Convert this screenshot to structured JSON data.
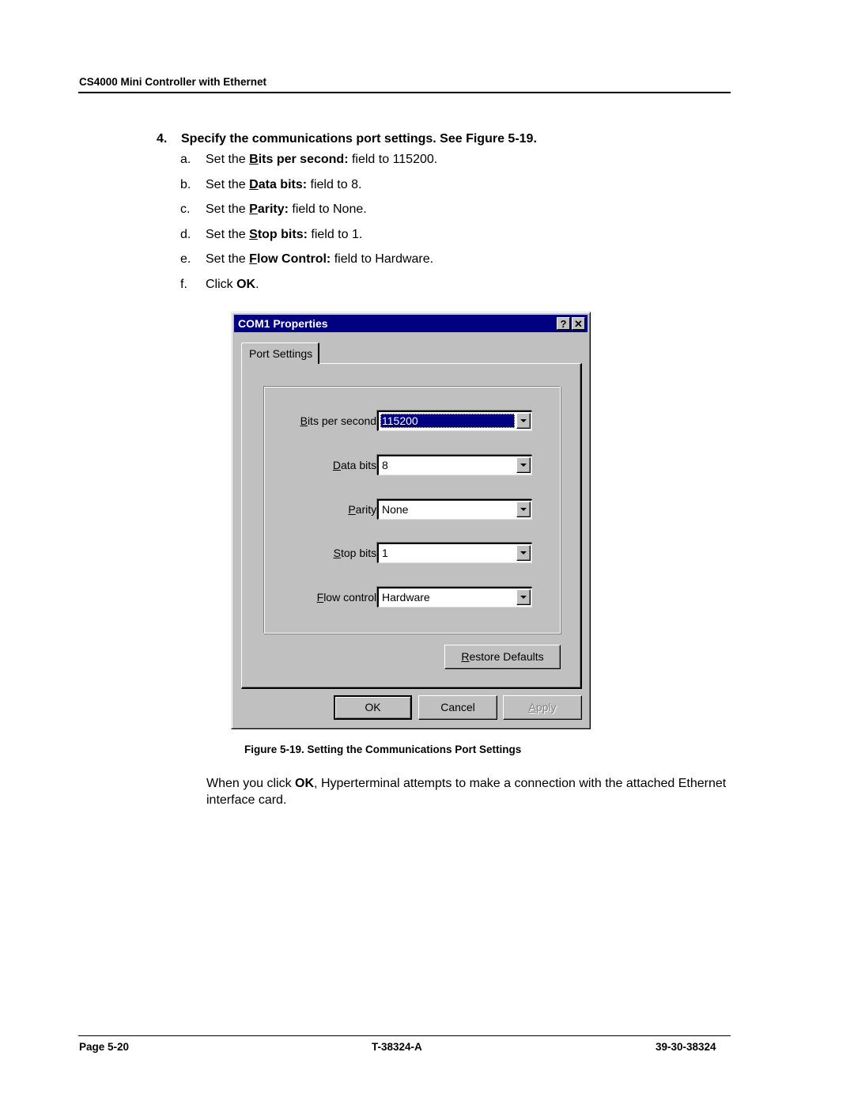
{
  "header": {
    "running_title": "CS4000 Mini Controller with Ethernet"
  },
  "step": {
    "number": "4.",
    "text": "Specify the communications port settings. See Figure 5-19."
  },
  "substeps": [
    {
      "letter": "a.",
      "prefix": "Set the ",
      "field_accel": "B",
      "field_rest": "its per second:",
      "suffix": " field to 115200."
    },
    {
      "letter": "b.",
      "prefix": "Set the ",
      "field_accel": "D",
      "field_rest": "ata bits:",
      "suffix": " field to 8."
    },
    {
      "letter": "c.",
      "prefix": "Set the ",
      "field_accel": "P",
      "field_rest": "arity:",
      "suffix": " field to None."
    },
    {
      "letter": "d.",
      "prefix": "Set the ",
      "field_accel": "S",
      "field_rest": "top bits:",
      "suffix": " field to 1."
    },
    {
      "letter": "e.",
      "prefix": "Set the ",
      "field_accel": "F",
      "field_rest": "low Control:",
      "suffix": " field to Hardware."
    },
    {
      "letter": "f.",
      "prefix": "Click ",
      "bold": "OK",
      "suffix": "."
    }
  ],
  "dialog": {
    "title": "COM1 Properties",
    "help_button": "?",
    "close_button": "✕",
    "tab_label": "Port Settings",
    "fields": [
      {
        "accel": "B",
        "rest": "its per second:",
        "value": "115200",
        "selected": true
      },
      {
        "accel": "D",
        "rest": "ata bits:",
        "value": "8"
      },
      {
        "accel": "P",
        "rest": "arity:",
        "value": "None"
      },
      {
        "accel": "S",
        "rest": "top bits:",
        "value": "1"
      },
      {
        "accel": "F",
        "rest": "low control:",
        "value": "Hardware"
      }
    ],
    "restore_defaults": {
      "accel": "R",
      "rest": "estore Defaults"
    },
    "ok_label": "OK",
    "cancel_label": "Cancel",
    "apply": {
      "accel": "A",
      "rest": "pply",
      "disabled": true
    }
  },
  "caption": "Figure 5-19. Setting the Communications Port Settings",
  "paragraph": {
    "before": "When you click ",
    "bold": "OK",
    "after": ", Hyperterminal attempts to make a connection with the attached Ethernet interface card."
  },
  "footer": {
    "page": "Page 5-20",
    "doc_id": "T-38324-A",
    "part_number": "39-30-38324"
  }
}
